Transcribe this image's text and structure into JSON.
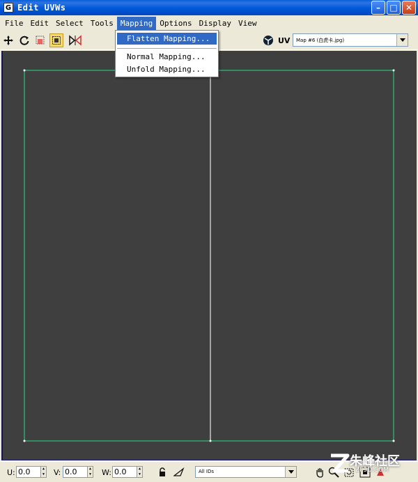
{
  "window": {
    "title": "Edit UVWs",
    "icon_letter": "G",
    "minimize_glyph": "–",
    "maximize_glyph": "□",
    "close_glyph": "✕"
  },
  "menubar": {
    "items": [
      "File",
      "Edit",
      "Select",
      "Tools",
      "Mapping",
      "Options",
      "Display",
      "View"
    ],
    "active": "Mapping"
  },
  "mapping_menu": {
    "items": [
      {
        "label": "Flatten Mapping...",
        "highlighted": true
      },
      {
        "label": "Normal Mapping...",
        "highlighted": false
      },
      {
        "label": "Unfold Mapping...",
        "highlighted": false
      }
    ]
  },
  "toolbar": {
    "tools": [
      "move-icon",
      "rotate-icon",
      "scale-icon",
      "freeform-icon",
      "mirror-icon"
    ],
    "active_tool": "freeform-icon",
    "uv_label": "UV",
    "map_select_value": "Map #6 (白虎卡.jpg)"
  },
  "statusbar": {
    "u_label": "U:",
    "u_value": "0.0",
    "v_label": "V:",
    "v_value": "0.0",
    "w_label": "W:",
    "w_value": "0.0",
    "ids_value": "All IDs"
  },
  "watermark": {
    "text": "朱峰社区",
    "url": "ZF3D.COM"
  },
  "colors": {
    "viewport_bg": "#3f3f3f",
    "uv_edge": "#2fc27a",
    "menu_highlight": "#316ac5"
  }
}
